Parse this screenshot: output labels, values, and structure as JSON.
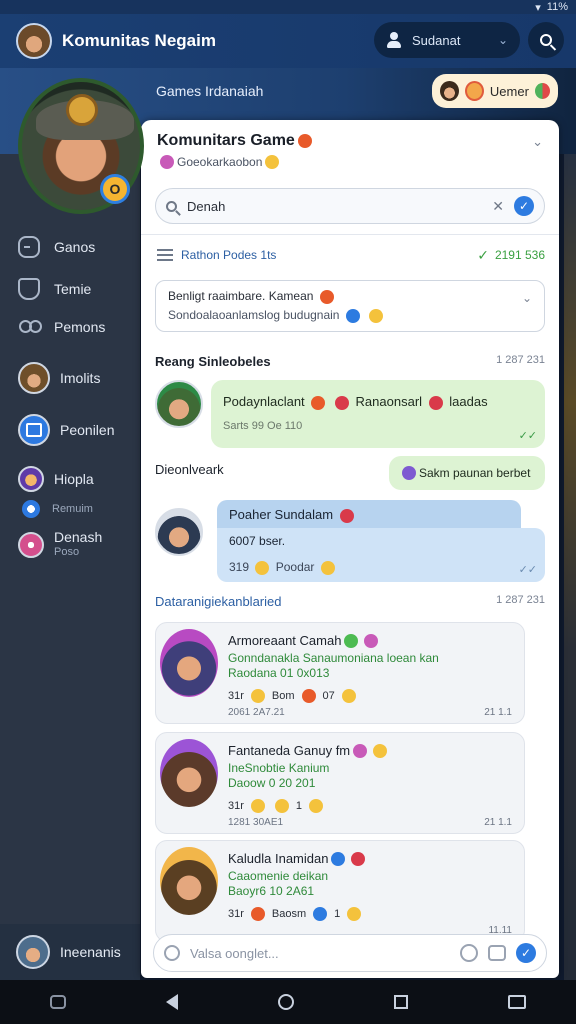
{
  "status": {
    "right_text": "11%"
  },
  "app": {
    "title": "Komunitas Negaim"
  },
  "header": {
    "search_text": "Sudanat"
  },
  "banner": {
    "text": "Games Irdanaiah",
    "react_label": "Uemer"
  },
  "sidebar": {
    "items": [
      {
        "label": "Ganos"
      },
      {
        "label": "Temie"
      },
      {
        "label": "Pemons"
      },
      {
        "label": "Imolits"
      },
      {
        "label": "Peonilen"
      },
      {
        "label": "Hiopla",
        "sub": "Remuim"
      },
      {
        "label": "Denash",
        "sub": "Poso"
      }
    ],
    "hero_badge": "O",
    "footer_label": "Ineenanis"
  },
  "panel": {
    "title": "Komunitars Game",
    "subtitle": "Goeokarkaobon",
    "search_value": "Denah",
    "list_label": "Rathon Podes 1ts",
    "list_right": "2191 536",
    "dropdown": {
      "line1": "Benligt raaimbare. Kamean",
      "line2": "Sondoalaoanlamslog budugnain"
    },
    "section1": {
      "title": "Reang Sinleobeles",
      "time": "1 287 231"
    },
    "msg1": {
      "text": "Podaynlaclant",
      "text2": "Ranaonsarl",
      "text3": "laadas",
      "meta": "Sarts 99 Oe 110"
    },
    "reply_pill": "Sakm paunan berbet",
    "section2": {
      "title": "Dieonlveark"
    },
    "msg2": {
      "header": "Poaher Sundalam",
      "line1": "6007 bser.",
      "line2": "319",
      "line2b": "Poodar"
    },
    "section3": {
      "title": "Dataranigiekanblaried",
      "time": "1 287 231"
    },
    "cards": [
      {
        "name": "Armoreaant Camah",
        "desc1": "Gonndanakla Sanaumoniana loean kan",
        "desc2": "Raodana 01 0x013",
        "meta_a": "31r",
        "meta_b": "Bom",
        "meta_c": "07",
        "date": "2061 2A7.21",
        "time": "21 1.1"
      },
      {
        "name": "Fantaneda Ganuy fm",
        "desc1": "IneSnobtie Kanium",
        "desc2": "Daoow 0 20 201",
        "meta_a": "31r",
        "meta_b": "",
        "meta_c": "1",
        "date": "1281 30AE1",
        "time": "21 1.1"
      },
      {
        "name": "Kaludla Inamidan",
        "desc1": "Caaomenie deikan",
        "desc2": "Baoyr6 10 2A61",
        "meta_a": "31r",
        "meta_b": "Baosm",
        "meta_c": "1",
        "date": "",
        "time": "11.11"
      }
    ],
    "composer_placeholder": "Valsa oonglet..."
  }
}
